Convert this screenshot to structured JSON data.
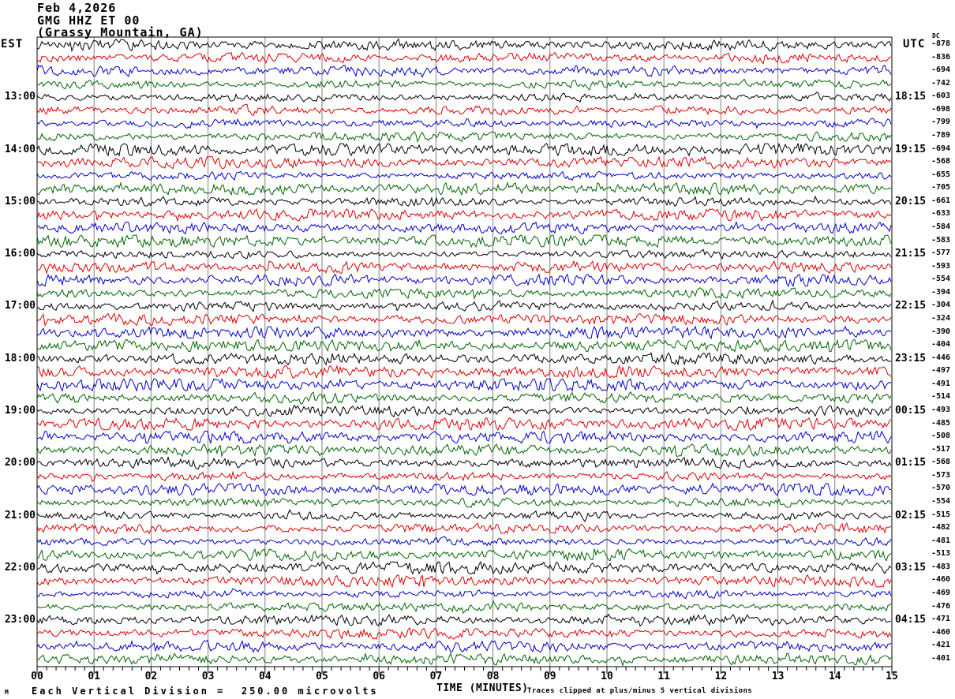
{
  "header": {
    "date": "Feb 4,2026",
    "station": "GMG HHZ ET 00",
    "location": "(Grassy Mountain, GA)"
  },
  "axes": {
    "left_title": "EST",
    "right_title": "UTC",
    "dc_title": "DC",
    "x_title": "TIME (MINUTES)",
    "x_ticks": [
      "00",
      "01",
      "02",
      "03",
      "04",
      "05",
      "06",
      "07",
      "08",
      "09",
      "10",
      "11",
      "12",
      "13",
      "14",
      "15"
    ]
  },
  "footer": {
    "watermark": "M",
    "scale_note": "Each Vertical Division =  250.00 microvolts",
    "clip_note": "Traces clipped at plus/minus 5 vertical divisions"
  },
  "chart_data": {
    "type": "line",
    "description": "Helicorder / webicorder seismogram: 48 quarter-hour trace rows, 15 minutes per row, colors cycling black-red-blue-green",
    "x_range_minutes": [
      0,
      15
    ],
    "minor_ticks_per_minute": 6,
    "rows_per_hour": 4,
    "grid": true,
    "colors": {
      "black": "#000000",
      "red": "#dd0000",
      "blue": "#0000cc",
      "green": "#006600"
    },
    "color_cycle": [
      "black",
      "red",
      "blue",
      "green"
    ],
    "rows": [
      {
        "color": "black",
        "est": "",
        "utc": "",
        "dc": "-878"
      },
      {
        "color": "red",
        "est": "",
        "utc": "",
        "dc": "-836"
      },
      {
        "color": "blue",
        "est": "",
        "utc": "",
        "dc": "-694"
      },
      {
        "color": "green",
        "est": "",
        "utc": "",
        "dc": "-742"
      },
      {
        "color": "black",
        "est": "13:00",
        "utc": "18:15",
        "dc": "-603"
      },
      {
        "color": "red",
        "est": "",
        "utc": "",
        "dc": "-698"
      },
      {
        "color": "blue",
        "est": "",
        "utc": "",
        "dc": "-799"
      },
      {
        "color": "green",
        "est": "",
        "utc": "",
        "dc": "-789"
      },
      {
        "color": "black",
        "est": "14:00",
        "utc": "19:15",
        "dc": "-694"
      },
      {
        "color": "red",
        "est": "",
        "utc": "",
        "dc": "-568"
      },
      {
        "color": "blue",
        "est": "",
        "utc": "",
        "dc": "-655"
      },
      {
        "color": "green",
        "est": "",
        "utc": "",
        "dc": "-705"
      },
      {
        "color": "black",
        "est": "15:00",
        "utc": "20:15",
        "dc": "-661"
      },
      {
        "color": "red",
        "est": "",
        "utc": "",
        "dc": "-633"
      },
      {
        "color": "blue",
        "est": "",
        "utc": "",
        "dc": "-584"
      },
      {
        "color": "green",
        "est": "",
        "utc": "",
        "dc": "-583"
      },
      {
        "color": "black",
        "est": "16:00",
        "utc": "21:15",
        "dc": "-577"
      },
      {
        "color": "red",
        "est": "",
        "utc": "",
        "dc": "-593"
      },
      {
        "color": "blue",
        "est": "",
        "utc": "",
        "dc": "-554"
      },
      {
        "color": "green",
        "est": "",
        "utc": "",
        "dc": "-394"
      },
      {
        "color": "black",
        "est": "17:00",
        "utc": "22:15",
        "dc": "-304"
      },
      {
        "color": "red",
        "est": "",
        "utc": "",
        "dc": "-324"
      },
      {
        "color": "blue",
        "est": "",
        "utc": "",
        "dc": "-390"
      },
      {
        "color": "green",
        "est": "",
        "utc": "",
        "dc": "-404"
      },
      {
        "color": "black",
        "est": "18:00",
        "utc": "23:15",
        "dc": "-446"
      },
      {
        "color": "red",
        "est": "",
        "utc": "",
        "dc": "-497"
      },
      {
        "color": "blue",
        "est": "",
        "utc": "",
        "dc": "-491"
      },
      {
        "color": "green",
        "est": "",
        "utc": "",
        "dc": "-514"
      },
      {
        "color": "black",
        "est": "19:00",
        "utc": "00:15",
        "dc": "-493"
      },
      {
        "color": "red",
        "est": "",
        "utc": "",
        "dc": "-485"
      },
      {
        "color": "blue",
        "est": "",
        "utc": "",
        "dc": "-508"
      },
      {
        "color": "green",
        "est": "",
        "utc": "",
        "dc": "-517"
      },
      {
        "color": "black",
        "est": "20:00",
        "utc": "01:15",
        "dc": "-568"
      },
      {
        "color": "red",
        "est": "",
        "utc": "",
        "dc": "-573"
      },
      {
        "color": "blue",
        "est": "",
        "utc": "",
        "dc": "-570"
      },
      {
        "color": "green",
        "est": "",
        "utc": "",
        "dc": "-554"
      },
      {
        "color": "black",
        "est": "21:00",
        "utc": "02:15",
        "dc": "-515"
      },
      {
        "color": "red",
        "est": "",
        "utc": "",
        "dc": "-482"
      },
      {
        "color": "blue",
        "est": "",
        "utc": "",
        "dc": "-481"
      },
      {
        "color": "green",
        "est": "",
        "utc": "",
        "dc": "-513"
      },
      {
        "color": "black",
        "est": "22:00",
        "utc": "03:15",
        "dc": "-483"
      },
      {
        "color": "red",
        "est": "",
        "utc": "",
        "dc": "-460"
      },
      {
        "color": "blue",
        "est": "",
        "utc": "",
        "dc": "-469"
      },
      {
        "color": "green",
        "est": "",
        "utc": "",
        "dc": "-476"
      },
      {
        "color": "black",
        "est": "23:00",
        "utc": "04:15",
        "dc": "-471"
      },
      {
        "color": "red",
        "est": "",
        "utc": "",
        "dc": "-460"
      },
      {
        "color": "blue",
        "est": "",
        "utc": "",
        "dc": "-421"
      },
      {
        "color": "green",
        "est": "",
        "utc": "",
        "dc": "-401"
      }
    ]
  }
}
